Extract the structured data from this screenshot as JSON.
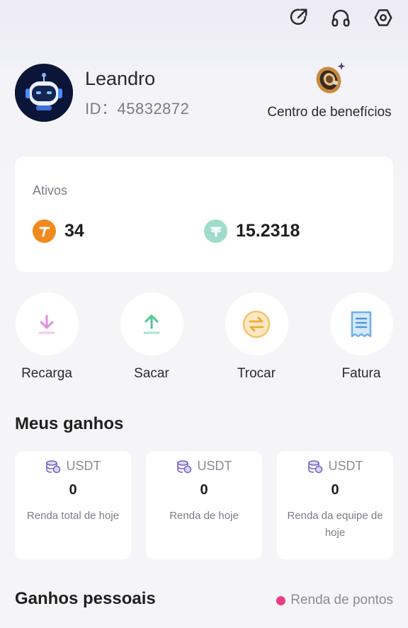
{
  "top_bar": {
    "icons": [
      "share-icon",
      "headset-icon",
      "settings-icon"
    ]
  },
  "profile": {
    "username": "Leandro",
    "id_text": "ID：45832872"
  },
  "benefits": {
    "label": "Centro de benefícios"
  },
  "assets": {
    "title": "Ativos",
    "items": [
      {
        "value": "34",
        "icon": "token-t-icon",
        "color": "#f08a1c"
      },
      {
        "value": "15.2318",
        "icon": "tether-icon",
        "color": "#9fdcc9"
      }
    ]
  },
  "actions": [
    {
      "label": "Recarga",
      "icon": "download-icon",
      "color": "#e58be0"
    },
    {
      "label": "Sacar",
      "icon": "upload-icon",
      "color": "#4fc592"
    },
    {
      "label": "Trocar",
      "icon": "exchange-icon",
      "color": "#f6c26a"
    },
    {
      "label": "Fatura",
      "icon": "receipt-icon",
      "color": "#6fb0e8"
    }
  ],
  "earnings": {
    "title": "Meus ganhos",
    "cards": [
      {
        "currency": "USDT",
        "value": "0",
        "label": "Renda total de hoje"
      },
      {
        "currency": "USDT",
        "value": "0",
        "label": "Renda de hoje"
      },
      {
        "currency": "USDT",
        "value": "0",
        "label": "Renda da equipe de hoje"
      }
    ]
  },
  "personal": {
    "title": "Ganhos pessoais",
    "legend": "Renda de pontos",
    "legend_color": "#ee3a83"
  }
}
